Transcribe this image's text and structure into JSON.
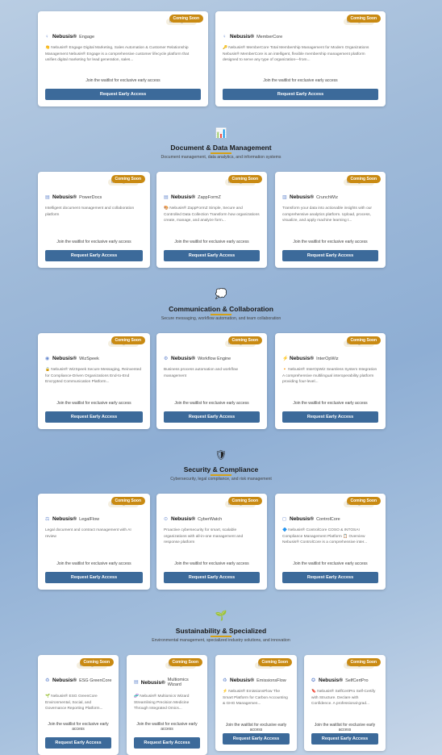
{
  "badge": "Coming Soon",
  "badge_ghost": "Coming Soon",
  "brand": "Nebusis®",
  "join": "Join the waitlist for exclusive early access",
  "button": "Request Early Access",
  "sections": [
    {
      "icon": "📊",
      "icon_name": "bar-chart-icon",
      "title": "Document & Data Management",
      "subtitle": "Document management, data analytics, and information systems"
    },
    {
      "icon": "💭",
      "icon_name": "thought-bubble-icon",
      "title": "Communication & Collaboration",
      "subtitle": "Secure messaging, workflow automation, and team collaboration"
    },
    {
      "icon": "🛡",
      "icon_name": "shield-icon",
      "title": "Security & Compliance",
      "subtitle": "Cybersecurity, legal compliance, and risk management"
    },
    {
      "icon": "🌱",
      "icon_name": "seedling-icon",
      "title": "Sustainability & Specialized",
      "subtitle": "Environmental management, specialized industry solutions, and innovation"
    }
  ],
  "products": [
    {
      "icon": "♀",
      "icon_name": "users-icon",
      "name": "Engage",
      "desc": "👏 Nebusis® Engage Digital Marketing, Sales Automation & Customer Relationship Management Nebusis® Engage is a comprehensive customer lifecycle platform that unifies digital marketing for lead generation, sales..."
    },
    {
      "icon": "♀",
      "icon_name": "users-icon",
      "name": "MemberCore",
      "desc": "🔑 Nebusis® MemberCore Total Membership Management for Modern Organizations Nebusis® MemberCore is an intelligent, flexible membership management platform designed to serve any type of organization—from..."
    },
    {
      "icon": "▤",
      "icon_name": "document-icon",
      "name": "PowerDocs",
      "desc": "Intelligent document management and collaboration platform"
    },
    {
      "icon": "▤",
      "icon_name": "form-icon",
      "name": "ZappFormZ",
      "desc": "🎨 Nebusis® ZappFormZ Simple, Secure and Controlled Data Collection Transform how organizations create, manage, and analyze form..."
    },
    {
      "icon": "▥",
      "icon_name": "chart-icon",
      "name": "CrunchWiz",
      "desc": "Transform your data into actionable insights with our comprehensive analytics platform. Upload, process, visualize, and apply machine learning t..."
    },
    {
      "icon": "◉",
      "icon_name": "speech-icon",
      "name": "WizSpeek",
      "desc": "🔒 Nebusis® WizSpeek Secure Messaging, Reinvented for Compliance-Driven Organizations End-to-End Encrypted Communication Platform..."
    },
    {
      "icon": "⚙",
      "icon_name": "gear-icon",
      "name": "Workflow Engine",
      "desc": "Business process automation and workflow management"
    },
    {
      "icon": "⚡",
      "icon_name": "lightning-icon",
      "name": "InterOpWiz",
      "desc": "🔸 Nebusis® InterOpWiz Seamless System Integration A comprehensive multilingual interoperability platform providing four-level..."
    },
    {
      "icon": "⚖",
      "icon_name": "scale-icon",
      "name": "LegalFlow",
      "desc": "Legal document and contract management with AI review"
    },
    {
      "icon": "⊙",
      "icon_name": "shield-check-icon",
      "name": "CyberWatch",
      "desc": "Proactive cybersecurity for smart, scalable organizations with all-in-one management and response platform"
    },
    {
      "icon": "◻",
      "icon_name": "clipboard-icon",
      "name": "ControlCore",
      "desc": "🔷 Nebusis® ControlCore COSO & INTOSAI Compliance Management Platform 📋 Overview Nebusis® ControlCore is a comprehensive inter..."
    },
    {
      "icon": "♻",
      "icon_name": "leaf-icon",
      "name": "ESG GreenCore",
      "desc": "🌱 Nebusis® ESG GreenCore Environmental, Social, and Governance Reporting Platform..."
    },
    {
      "icon": "▤",
      "icon_name": "dna-icon",
      "name": "Multiomics Wizard",
      "desc": "🧬 Nebusis® Multiomics Wizard Streamlining Precision Medicine Through Integrated Omics..."
    },
    {
      "icon": "♻",
      "icon_name": "recycle-icon",
      "name": "EmissionsFlow",
      "desc": "⚡ Nebusis® EmissionsFlow The Smart Platform for Carbon Accounting & GHG Managemen..."
    },
    {
      "icon": "✪",
      "icon_name": "certificate-icon",
      "name": "SelfCertPro",
      "desc": "🔖 Nebusis® SelfCertPro Self-Certify with Structure. Declare with Confidence. A professional-grad..."
    }
  ]
}
